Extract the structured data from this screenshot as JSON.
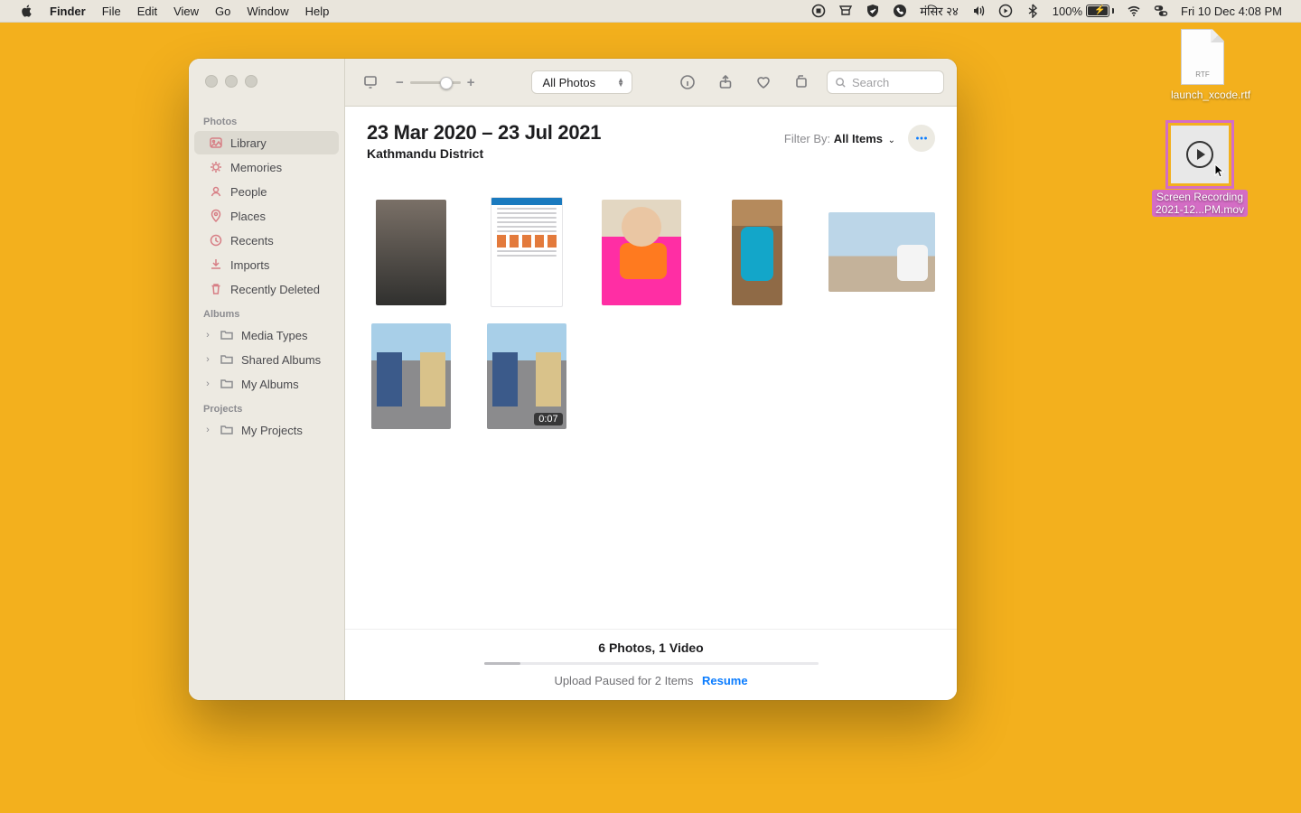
{
  "menubar": {
    "app": "Finder",
    "items": [
      "File",
      "Edit",
      "View",
      "Go",
      "Window",
      "Help"
    ],
    "date_extra": "मंसिर २४",
    "battery_pct": "100%",
    "clock": "Fri 10 Dec  4:08 PM"
  },
  "win": {
    "view_select": "All Photos",
    "search_placeholder": "Search",
    "zoom_minus": "−",
    "zoom_plus": "+"
  },
  "sidebar": {
    "section_photos": "Photos",
    "photos_items": [
      "Library",
      "Memories",
      "People",
      "Places",
      "Recents",
      "Imports",
      "Recently Deleted"
    ],
    "section_albums": "Albums",
    "albums_items": [
      "Media Types",
      "Shared Albums",
      "My Albums"
    ],
    "section_projects": "Projects",
    "projects_items": [
      "My Projects"
    ]
  },
  "header": {
    "title": "23 Mar 2020 – 23 Jul 2021",
    "subtitle": "Kathmandu District",
    "filter_label": "Filter By:",
    "filter_value": "All Items",
    "more_label": "•••"
  },
  "grid": {
    "video_duration": "0:07"
  },
  "footer": {
    "count": "6 Photos, 1 Video",
    "upload_text": "Upload Paused for 2 Items",
    "resume": "Resume"
  },
  "desktop": {
    "rtf_tag": "RTF",
    "rtf_label": "launch_xcode.rtf",
    "mov_label_l1": "Screen Recording",
    "mov_label_l2": "2021-12...PM.mov"
  }
}
